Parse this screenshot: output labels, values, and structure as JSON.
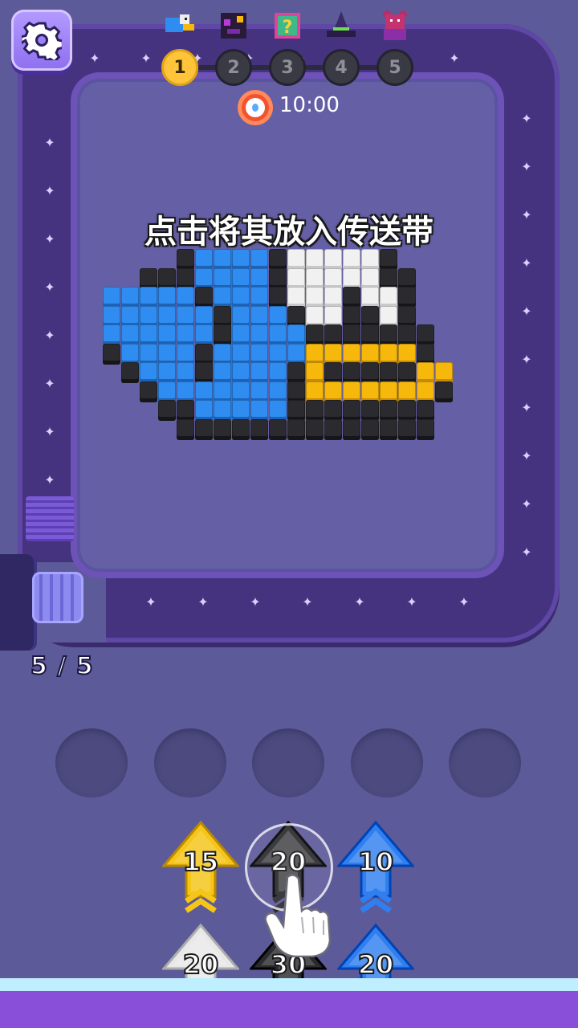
{
  "header": {
    "levels": [
      {
        "label": "1",
        "icon": "blue-bird-icon",
        "active": true
      },
      {
        "label": "2",
        "icon": "dark-creature-icon",
        "active": false
      },
      {
        "label": "3",
        "icon": "mystery-box-icon",
        "active": false
      },
      {
        "label": "4",
        "icon": "witch-hat-icon",
        "active": false
      },
      {
        "label": "5",
        "icon": "red-bear-icon",
        "active": false
      }
    ],
    "timer": "10:00"
  },
  "instruction": "点击将其放入传送带",
  "feeder": {
    "count": "5 / 5"
  },
  "pixel_art": {
    "subject": "blue-bird",
    "palette": {
      "K": "#2b2b2f",
      "B": "#2f8df2",
      "W": "#f1f1f1",
      "Y": "#f6b80b"
    }
  },
  "holding_slots": 5,
  "shooters": {
    "front_row": [
      {
        "value": "15",
        "color": "#f5c518"
      },
      {
        "value": "20",
        "color": "#2b2b2f"
      },
      {
        "value": "10",
        "color": "#2f7ff0"
      }
    ],
    "back_row": [
      {
        "value": "20",
        "color": "#e8e8e8"
      },
      {
        "value": "30",
        "color": "#2b2b2f"
      },
      {
        "value": "20",
        "color": "#2f7ff0"
      }
    ]
  },
  "colors": {
    "background": "#5d5a99",
    "track": "#46337f",
    "accent": "#ffc43a",
    "bottom_bar": "#8a4fd8"
  }
}
